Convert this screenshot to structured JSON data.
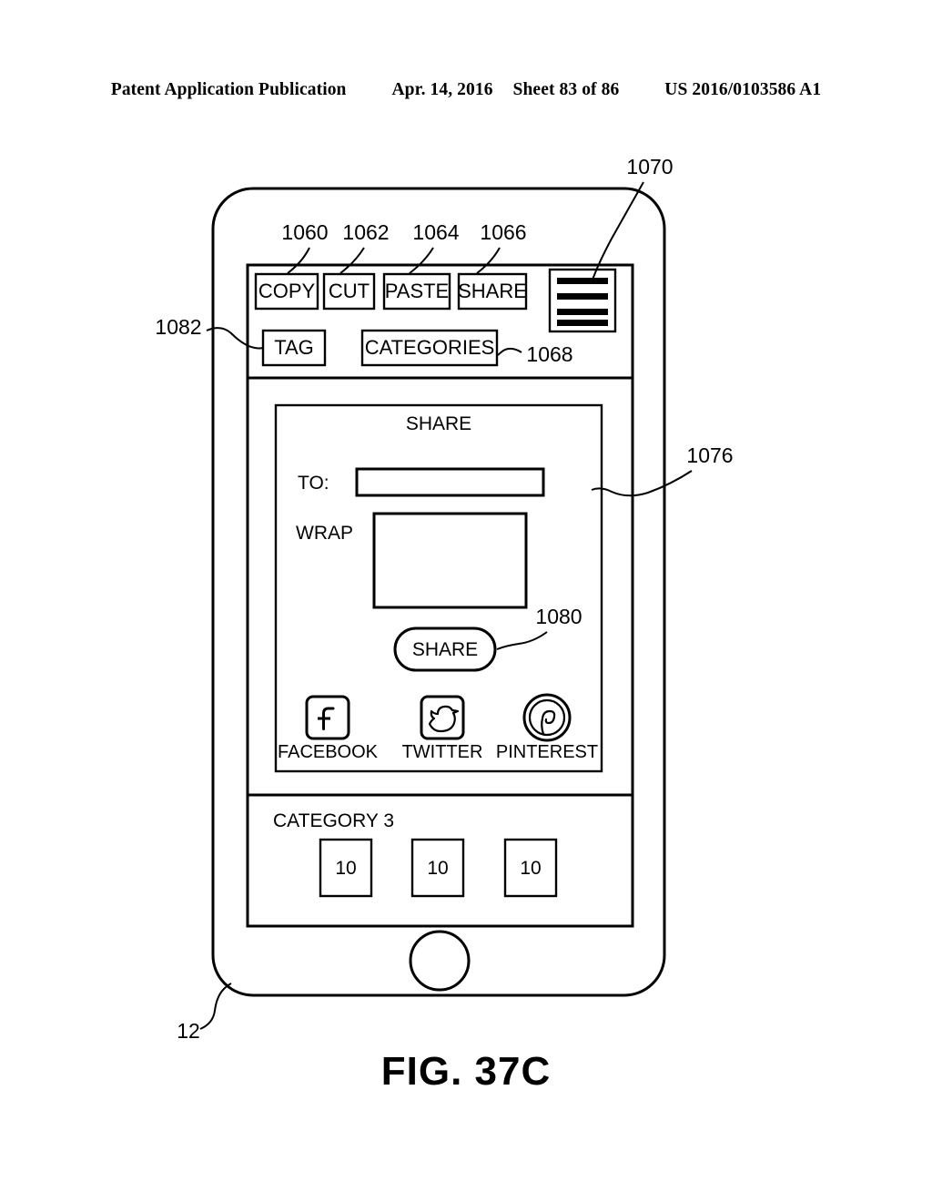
{
  "header": {
    "publication": "Patent Application Publication",
    "date": "Apr. 14, 2016",
    "sheet": "Sheet 83 of 86",
    "patent_number": "US 2016/0103586 A1"
  },
  "figure": {
    "caption": "FIG. 37C",
    "device_ref": "12"
  },
  "toolbar": {
    "buttons": [
      {
        "label": "COPY",
        "ref": "1060"
      },
      {
        "label": "CUT",
        "ref": "1062"
      },
      {
        "label": "PASTE",
        "ref": "1064"
      },
      {
        "label": "SHARE",
        "ref": "1066"
      }
    ],
    "menu_icon": {
      "name": "hamburger-menu-icon",
      "ref": "1070",
      "bars": 4
    },
    "tag_button": {
      "label": "TAG",
      "ref": "1082"
    },
    "categories_button": {
      "label": "CATEGORIES",
      "ref": "1068"
    }
  },
  "share_dialog": {
    "ref": "1076",
    "title": "SHARE",
    "to_label": "TO:",
    "to_value": "",
    "wrap_label": "WRAP",
    "wrap_value": "",
    "share_button": {
      "label": "SHARE",
      "ref": "1080"
    },
    "social": [
      {
        "label": "FACEBOOK",
        "icon": "facebook-icon"
      },
      {
        "label": "TWITTER",
        "icon": "twitter-icon"
      },
      {
        "label": "PINTEREST",
        "icon": "pinterest-icon"
      }
    ]
  },
  "category_section": {
    "title": "CATEGORY 3",
    "items": [
      {
        "label": "10"
      },
      {
        "label": "10"
      },
      {
        "label": "10"
      }
    ]
  },
  "colors": {
    "ink": "#000000",
    "paper": "#ffffff"
  }
}
